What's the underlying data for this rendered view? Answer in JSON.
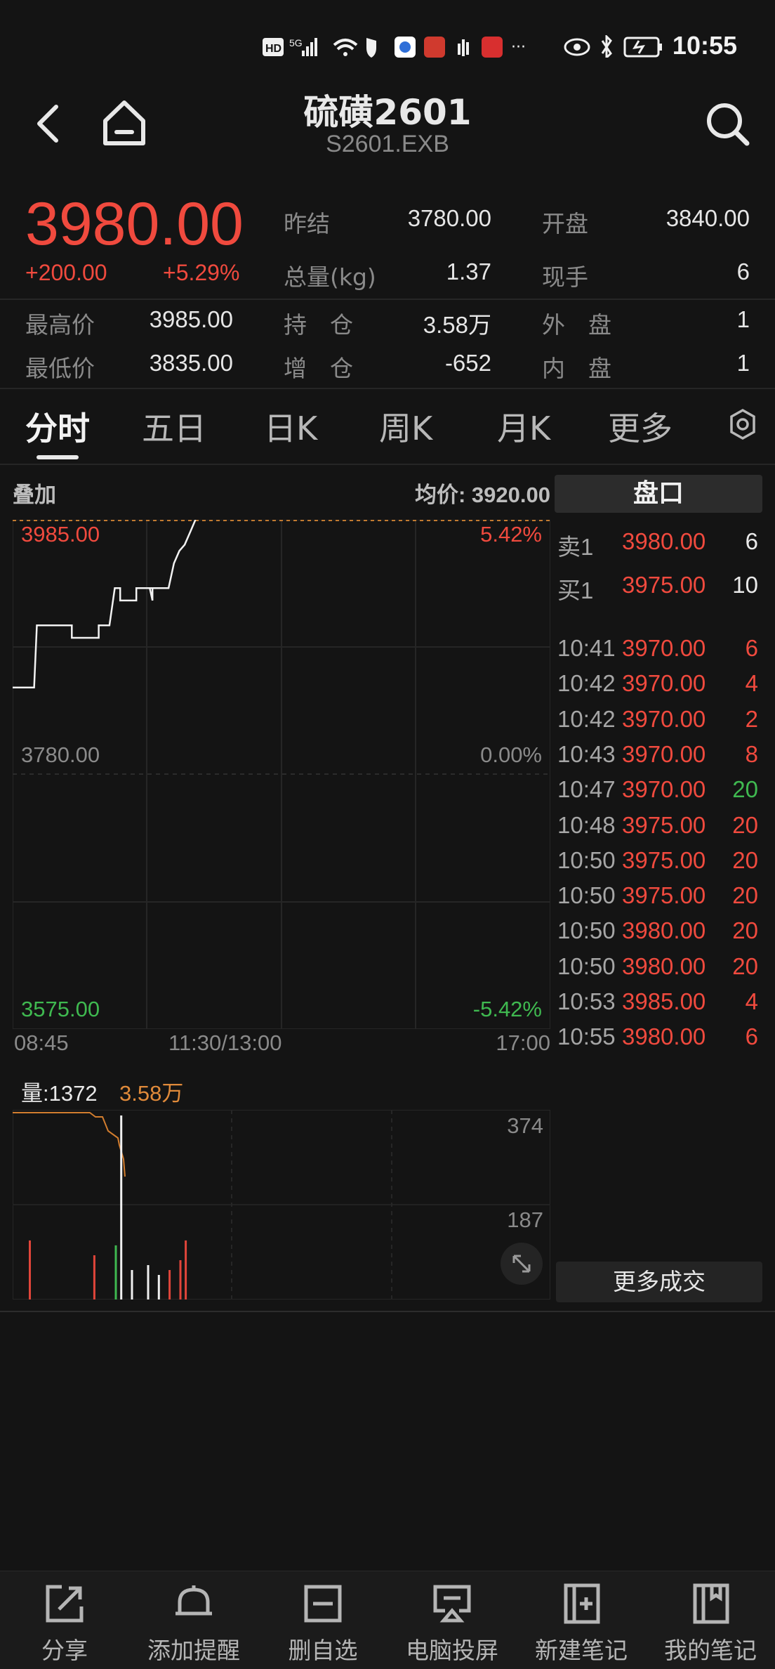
{
  "status_bar": {
    "time": "10:55"
  },
  "header": {
    "title": "硫磺2601",
    "subtitle": "S2601.EXB"
  },
  "quote": {
    "last_price": "3980.00",
    "change": "+200.00",
    "change_pct": "+5.29%",
    "fields": [
      {
        "label": "昨结",
        "value": "3780.00"
      },
      {
        "label": "开盘",
        "value": "3840.00"
      },
      {
        "label": "总量(kg)",
        "value": "1.37"
      },
      {
        "label": "现手",
        "value": "6"
      },
      {
        "label": "最高价",
        "value": "3985.00"
      },
      {
        "label": "持　仓",
        "value": "3.58万"
      },
      {
        "label": "外　盘",
        "value": "1"
      },
      {
        "label": "最低价",
        "value": "3835.00"
      },
      {
        "label": "增　仓",
        "value": "-652"
      },
      {
        "label": "内　盘",
        "value": "1"
      }
    ]
  },
  "tabs": [
    "分时",
    "五日",
    "日K",
    "周K",
    "月K",
    "更多"
  ],
  "chart": {
    "overlay_label": "叠加",
    "avg_label": "均价: 3920.00",
    "top_price": "3985.00",
    "top_pct": "5.42%",
    "mid_price": "3780.00",
    "mid_pct": "0.00%",
    "bottom_price": "3575.00",
    "bottom_pct": "-5.42%",
    "time_start": "08:45",
    "time_mid": "11:30/13:00",
    "time_end": "17:00",
    "volume_label": "量:1372",
    "oi_label": "3.58万",
    "vol_top": "374",
    "vol_mid": "187"
  },
  "chart_data": {
    "type": "line",
    "title": "",
    "ylim": [
      3575,
      3985
    ],
    "xlim_label": [
      "08:45",
      "17:00"
    ],
    "series": [
      {
        "values": [
          [
            0.0,
            3850
          ],
          [
            0.04,
            3850
          ],
          [
            0.045,
            3900
          ],
          [
            0.11,
            3900
          ],
          [
            0.11,
            3890
          ],
          [
            0.16,
            3890
          ],
          [
            0.16,
            3900
          ],
          [
            0.18,
            3900
          ],
          [
            0.19,
            3930
          ],
          [
            0.2,
            3930
          ],
          [
            0.2,
            3920
          ],
          [
            0.23,
            3920
          ],
          [
            0.23,
            3930
          ],
          [
            0.26,
            3930
          ],
          [
            0.26,
            3920
          ],
          [
            0.255,
            3930
          ],
          [
            0.29,
            3930
          ],
          [
            0.3,
            3950
          ],
          [
            0.31,
            3960
          ],
          [
            0.32,
            3965
          ],
          [
            0.33,
            3975
          ],
          [
            0.34,
            3985
          ]
        ]
      }
    ],
    "volume_ylim": [
      0,
      374
    ],
    "volume_bars": [
      {
        "x": 0.03,
        "v": 120,
        "color": "red"
      },
      {
        "x": 0.15,
        "v": 90,
        "color": "red"
      },
      {
        "x": 0.19,
        "v": 110,
        "color": "green"
      },
      {
        "x": 0.2,
        "v": 374,
        "color": "white"
      },
      {
        "x": 0.22,
        "v": 60,
        "color": "white"
      },
      {
        "x": 0.25,
        "v": 70,
        "color": "white"
      },
      {
        "x": 0.27,
        "v": 50,
        "color": "white"
      },
      {
        "x": 0.29,
        "v": 60,
        "color": "red"
      },
      {
        "x": 0.31,
        "v": 80,
        "color": "red"
      },
      {
        "x": 0.32,
        "v": 120,
        "color": "red"
      }
    ]
  },
  "order_book": {
    "title": "盘口",
    "asks": [
      {
        "label": "卖1",
        "price": "3980.00",
        "vol": "6"
      }
    ],
    "bids": [
      {
        "label": "买1",
        "price": "3975.00",
        "vol": "10"
      }
    ],
    "trades": [
      {
        "time": "10:41",
        "price": "3970.00",
        "vol": "6",
        "color": "red"
      },
      {
        "time": "10:42",
        "price": "3970.00",
        "vol": "4",
        "color": "red"
      },
      {
        "time": "10:42",
        "price": "3970.00",
        "vol": "2",
        "color": "red"
      },
      {
        "time": "10:43",
        "price": "3970.00",
        "vol": "8",
        "color": "red"
      },
      {
        "time": "10:47",
        "price": "3970.00",
        "vol": "20",
        "color": "green"
      },
      {
        "time": "10:48",
        "price": "3975.00",
        "vol": "20",
        "color": "red"
      },
      {
        "time": "10:50",
        "price": "3975.00",
        "vol": "20",
        "color": "red"
      },
      {
        "time": "10:50",
        "price": "3975.00",
        "vol": "20",
        "color": "red"
      },
      {
        "time": "10:50",
        "price": "3980.00",
        "vol": "20",
        "color": "red"
      },
      {
        "time": "10:50",
        "price": "3980.00",
        "vol": "20",
        "color": "red"
      },
      {
        "time": "10:53",
        "price": "3985.00",
        "vol": "4",
        "color": "red"
      },
      {
        "time": "10:55",
        "price": "3980.00",
        "vol": "6",
        "color": "red"
      }
    ],
    "more_label": "更多成交"
  },
  "bottom_bar": [
    "分享",
    "添加提醒",
    "删自选",
    "电脑投屏",
    "新建笔记",
    "我的笔记"
  ]
}
